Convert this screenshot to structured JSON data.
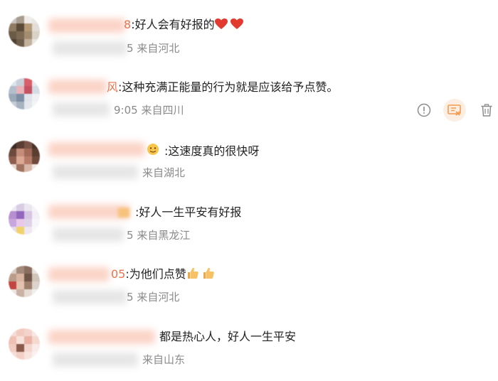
{
  "comments": [
    {
      "name_tail": "8",
      "text": ":好人会有好报的",
      "emoji": [
        "heart",
        "heart"
      ],
      "meta_tail": "5",
      "location": "来自河北"
    },
    {
      "name_tail": "风",
      "text": ":这种充满正能量的行为就是应该给予点赞。",
      "emoji": [],
      "meta_tail": "9:05",
      "location": "来自四川"
    },
    {
      "name_tail": "",
      "text": ":这速度真的很快呀",
      "emoji": [],
      "meta_tail": "",
      "location": "来自湖北"
    },
    {
      "name_tail": "",
      "text": ":好人一生平安有好报",
      "emoji": [],
      "meta_tail": "5",
      "location": "来自黑龙江"
    },
    {
      "name_tail": "05",
      "text": ":为他们点赞",
      "emoji": [
        "thumbs-up",
        "thumbs-up"
      ],
      "meta_tail": "5",
      "location": "来自河北"
    },
    {
      "name_tail": "",
      "text": "都是热心人，好人一生平安",
      "emoji": [],
      "meta_tail": "",
      "location": "来自山东"
    }
  ],
  "actions": [
    {
      "icon": "exclamation-circle-icon"
    },
    {
      "icon": "report-flag-icon",
      "active": true
    },
    {
      "icon": "trash-icon"
    }
  ],
  "colors": {
    "username": "#eb7350",
    "meta": "#8a8a8a",
    "text": "#222222",
    "report_active_bg": "#fdeee3",
    "report_active_icon": "#f59a4e",
    "icon_gray": "#8c8c8c"
  }
}
